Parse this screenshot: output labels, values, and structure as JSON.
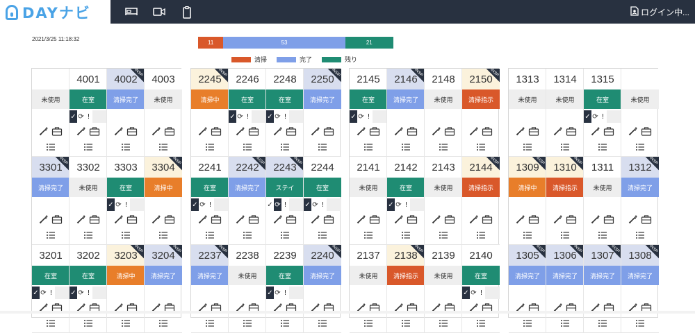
{
  "header": {
    "logo_text": "DAYナビ",
    "nav_icons": [
      "bed-icon",
      "video-camera-icon",
      "clipboard-icon"
    ],
    "login_label": "ログイン中..."
  },
  "timestamp": "2021/3/25 11:18:32",
  "progress": {
    "segments": [
      {
        "label": "11",
        "value": 11,
        "color": "#d9582a"
      },
      {
        "label": "53",
        "value": 53,
        "color": "#7f9fe8"
      },
      {
        "label": "21",
        "value": 21,
        "color": "#1f8c73"
      }
    ]
  },
  "legend": [
    {
      "label": "清掃",
      "color": "#d9582a"
    },
    {
      "label": "完了",
      "color": "#7f9fe8"
    },
    {
      "label": "残り",
      "color": "#1f8c73"
    }
  ],
  "status_colors": {
    "未使用": {
      "bg": "#eeeeee",
      "fg": "#333333"
    },
    "在室": {
      "bg": "#1f8c73",
      "fg": "#ffffff"
    },
    "清掃完了": {
      "bg": "#7f9fe8",
      "fg": "#ffffff"
    },
    "清掃中": {
      "bg": "#e87e2a",
      "fg": "#ffffff"
    },
    "清掃指示": {
      "bg": "#d9582a",
      "fg": "#ffffff"
    },
    "ステイ": {
      "bg": "#1f8c73",
      "fg": "#ffffff"
    }
  },
  "header_tints": {
    "none": "#ffffff",
    "blue": "#d8deef",
    "cream": "#fbf2dc"
  },
  "blocks": [
    {
      "rooms": [
        {
          "number": "",
          "status": "未使用",
          "tint": "none",
          "insp": false,
          "icons": false
        },
        {
          "number": "4001",
          "status": "在室",
          "tint": "none",
          "insp": false,
          "icons": "check"
        },
        {
          "number": "4002",
          "status": "清掃完了",
          "tint": "blue",
          "insp": true,
          "icons": false
        },
        {
          "number": "4003",
          "status": "未使用",
          "tint": "none",
          "insp": false,
          "icons": false
        },
        {
          "number": "3301",
          "status": "清掃完了",
          "tint": "blue",
          "insp": true,
          "icons": false
        },
        {
          "number": "3302",
          "status": "未使用",
          "tint": "none",
          "insp": false,
          "icons": false
        },
        {
          "number": "3303",
          "status": "在室",
          "tint": "none",
          "insp": false,
          "icons": "check"
        },
        {
          "number": "3304",
          "status": "清掃中",
          "tint": "cream",
          "insp": true,
          "icons": false
        },
        {
          "number": "3201",
          "status": "在室",
          "tint": "none",
          "insp": false,
          "icons": "check"
        },
        {
          "number": "3202",
          "status": "在室",
          "tint": "none",
          "insp": false,
          "icons": "check"
        },
        {
          "number": "3203",
          "status": "清掃中",
          "tint": "cream",
          "insp": true,
          "icons": false
        },
        {
          "number": "3204",
          "status": "清掃完了",
          "tint": "blue",
          "insp": true,
          "icons": false
        }
      ]
    },
    {
      "rooms": [
        {
          "number": "2245",
          "status": "清掃中",
          "tint": "cream",
          "insp": true,
          "icons": false
        },
        {
          "number": "2246",
          "status": "在室",
          "tint": "none",
          "insp": false,
          "icons": "check"
        },
        {
          "number": "2248",
          "status": "在室",
          "tint": "none",
          "insp": false,
          "icons": "check"
        },
        {
          "number": "2250",
          "status": "清掃完了",
          "tint": "blue",
          "insp": true,
          "icons": false
        },
        {
          "number": "2241",
          "status": "在室",
          "tint": "none",
          "insp": false,
          "icons": "check"
        },
        {
          "number": "2242",
          "status": "清掃完了",
          "tint": "blue",
          "insp": true,
          "icons": false
        },
        {
          "number": "2243",
          "status": "ステイ",
          "tint": "blue",
          "insp": true,
          "icons": "sync"
        },
        {
          "number": "2244",
          "status": "在室",
          "tint": "none",
          "insp": false,
          "icons": "check"
        },
        {
          "number": "2237",
          "status": "清掃完了",
          "tint": "blue",
          "insp": true,
          "icons": false
        },
        {
          "number": "2238",
          "status": "未使用",
          "tint": "none",
          "insp": false,
          "icons": false
        },
        {
          "number": "2239",
          "status": "在室",
          "tint": "none",
          "insp": false,
          "icons": "check"
        },
        {
          "number": "2240",
          "status": "清掃完了",
          "tint": "blue",
          "insp": true,
          "icons": false
        }
      ]
    },
    {
      "rooms": [
        {
          "number": "2145",
          "status": "在室",
          "tint": "none",
          "insp": false,
          "icons": "check"
        },
        {
          "number": "2146",
          "status": "清掃完了",
          "tint": "blue",
          "insp": true,
          "icons": false
        },
        {
          "number": "2148",
          "status": "未使用",
          "tint": "none",
          "insp": false,
          "icons": false
        },
        {
          "number": "2150",
          "status": "清掃指示",
          "tint": "cream",
          "insp": true,
          "icons": false
        },
        {
          "number": "2141",
          "status": "未使用",
          "tint": "none",
          "insp": false,
          "icons": false
        },
        {
          "number": "2142",
          "status": "在室",
          "tint": "none",
          "insp": false,
          "icons": "check"
        },
        {
          "number": "2143",
          "status": "未使用",
          "tint": "none",
          "insp": false,
          "icons": false
        },
        {
          "number": "2144",
          "status": "清掃指示",
          "tint": "cream",
          "insp": true,
          "icons": false
        },
        {
          "number": "2137",
          "status": "未使用",
          "tint": "none",
          "insp": false,
          "icons": false
        },
        {
          "number": "2138",
          "status": "清掃指示",
          "tint": "cream",
          "insp": true,
          "icons": false
        },
        {
          "number": "2139",
          "status": "未使用",
          "tint": "none",
          "insp": false,
          "icons": false
        },
        {
          "number": "2140",
          "status": "在室",
          "tint": "none",
          "insp": false,
          "icons": "check"
        }
      ]
    },
    {
      "rooms": [
        {
          "number": "1313",
          "status": "未使用",
          "tint": "none",
          "insp": false,
          "icons": false
        },
        {
          "number": "1314",
          "status": "未使用",
          "tint": "none",
          "insp": false,
          "icons": false
        },
        {
          "number": "1315",
          "status": "在室",
          "tint": "none",
          "insp": false,
          "icons": "check"
        },
        {
          "number": "",
          "status": "未使用",
          "tint": "none",
          "insp": false,
          "icons": false
        },
        {
          "number": "1309",
          "status": "清掃中",
          "tint": "cream",
          "insp": true,
          "icons": false
        },
        {
          "number": "1310",
          "status": "清掃指示",
          "tint": "cream",
          "insp": true,
          "icons": false
        },
        {
          "number": "1311",
          "status": "未使用",
          "tint": "none",
          "insp": false,
          "icons": false
        },
        {
          "number": "1312",
          "status": "清掃完了",
          "tint": "blue",
          "insp": true,
          "icons": false
        },
        {
          "number": "1305",
          "status": "清掃完了",
          "tint": "blue",
          "insp": true,
          "icons": false
        },
        {
          "number": "1306",
          "status": "清掃完了",
          "tint": "blue",
          "insp": true,
          "icons": false
        },
        {
          "number": "1307",
          "status": "清掃完了",
          "tint": "blue",
          "insp": true,
          "icons": false
        },
        {
          "number": "1308",
          "status": "清掃完了",
          "tint": "blue",
          "insp": true,
          "icons": false
        }
      ]
    }
  ],
  "insp_label": "INSP",
  "row_icon_glyphs": {
    "check": "✓",
    "sync": "⟳",
    "alert": "!"
  }
}
